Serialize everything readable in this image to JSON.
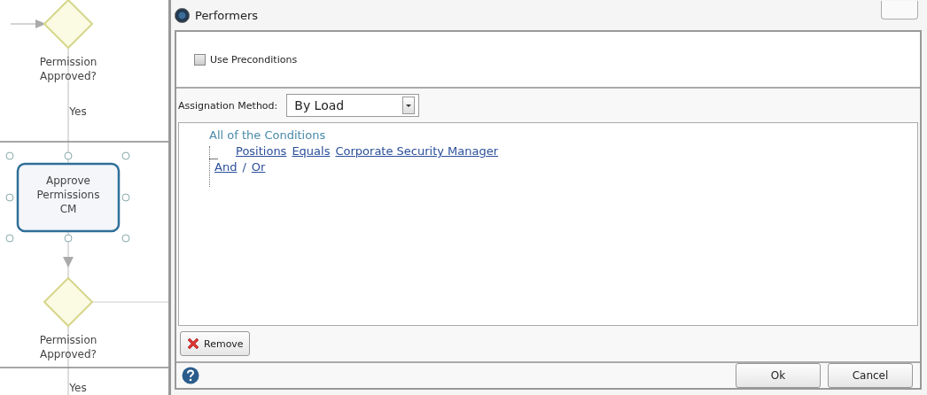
{
  "diagram": {
    "nodes": [
      {
        "kind": "gateway",
        "label": "Permission Approved?"
      },
      {
        "kind": "task",
        "label": "Approve Permissions CM",
        "selected": true
      },
      {
        "kind": "gateway",
        "label": "Permission Approved?"
      }
    ],
    "edge_labels": [
      "Yes",
      "Yes"
    ]
  },
  "dialog": {
    "title": "Performers",
    "use_preconditions": {
      "label": "Use Preconditions",
      "checked": false
    },
    "assignation_method": {
      "label": "Assignation Method:",
      "value": "By Load"
    },
    "conditions": {
      "root": "All of the Conditions",
      "rule": [
        "Positions",
        "Equals",
        "Corporate Security Manager"
      ],
      "and": "And",
      "separator": "/",
      "or": "Or"
    },
    "remove_button": "Remove",
    "buttons": [
      "Ok",
      "Cancel"
    ]
  }
}
